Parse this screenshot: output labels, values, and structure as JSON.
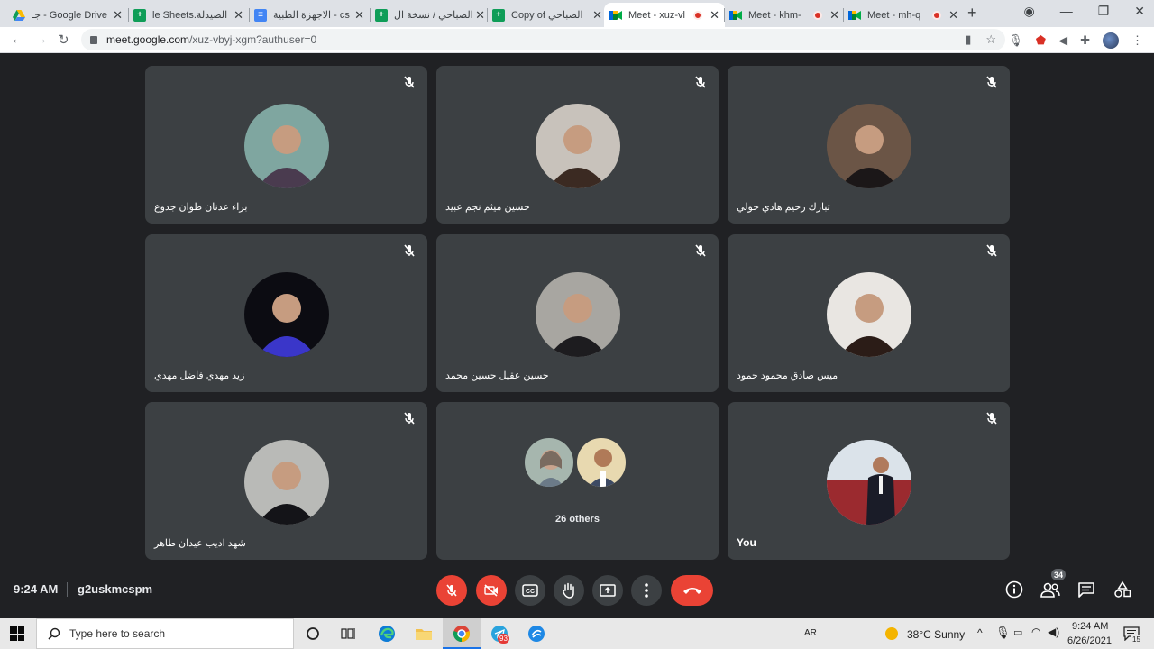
{
  "browser": {
    "tabs": [
      {
        "title": "جـ - Google Drive",
        "icon": "drive-icon",
        "color": "#1a73e8"
      },
      {
        "title": "le Sheets.الصيدلة",
        "icon": "sheets-icon",
        "color": "#0f9d58"
      },
      {
        "title": "الاجهزة الطبية - cs",
        "icon": "docs-icon",
        "color": "#4285f4"
      },
      {
        "title": "الصباحي / نسخة ال",
        "icon": "sheets-icon",
        "color": "#0f9d58"
      },
      {
        "title": "Copy of الصباحي",
        "icon": "sheets-icon",
        "color": "#0f9d58"
      },
      {
        "title": "Meet - xuz-vl",
        "icon": "meet-icon",
        "color": "#00832d"
      },
      {
        "title": "Meet - khm-",
        "icon": "meet-icon",
        "color": "#00832d"
      },
      {
        "title": "Meet - mh-q",
        "icon": "meet-icon",
        "color": "#00832d"
      }
    ],
    "url_host": "meet.google.com",
    "url_path": "/xuz-vbyj-xgm?authuser=0"
  },
  "meet": {
    "participants": [
      {
        "name": "براء عدنان طوان جدوع",
        "bg": "#7fa6a0",
        "fg": "#4a3b4f",
        "muted": true
      },
      {
        "name": "حسين ميثم نجم عبيد",
        "bg": "#c8c2bb",
        "fg": "#3b2a22",
        "muted": true
      },
      {
        "name": "تبارك رحيم هادي حولي",
        "bg": "#6b5546",
        "fg": "#1b1718",
        "muted": true
      },
      {
        "name": "زيد مهدي فاضل مهدي",
        "bg": "#0c0c12",
        "fg": "#3a36c9",
        "muted": true
      },
      {
        "name": "حسين عقيل حسين محمد",
        "bg": "#a8a6a1",
        "fg": "#1d1c1f",
        "muted": true
      },
      {
        "name": "ميس صادق محمود حمود",
        "bg": "#e9e6e2",
        "fg": "#2b1c17",
        "muted": true
      },
      {
        "name": "شهد اديب عيدان طاهر",
        "bg": "#b9bab7",
        "fg": "#141418",
        "muted": true
      }
    ],
    "others_label": "26 others",
    "you_label": "You",
    "time": "9:24 AM",
    "meeting_code": "g2uskmcspm",
    "participant_count": "34"
  },
  "taskbar": {
    "search_placeholder": "Type here to search",
    "language": "AR",
    "weather": "38°C  Sunny",
    "time": "9:24 AM",
    "date": "6/26/2021",
    "notification_count": "15",
    "telegram_badge": "93"
  }
}
